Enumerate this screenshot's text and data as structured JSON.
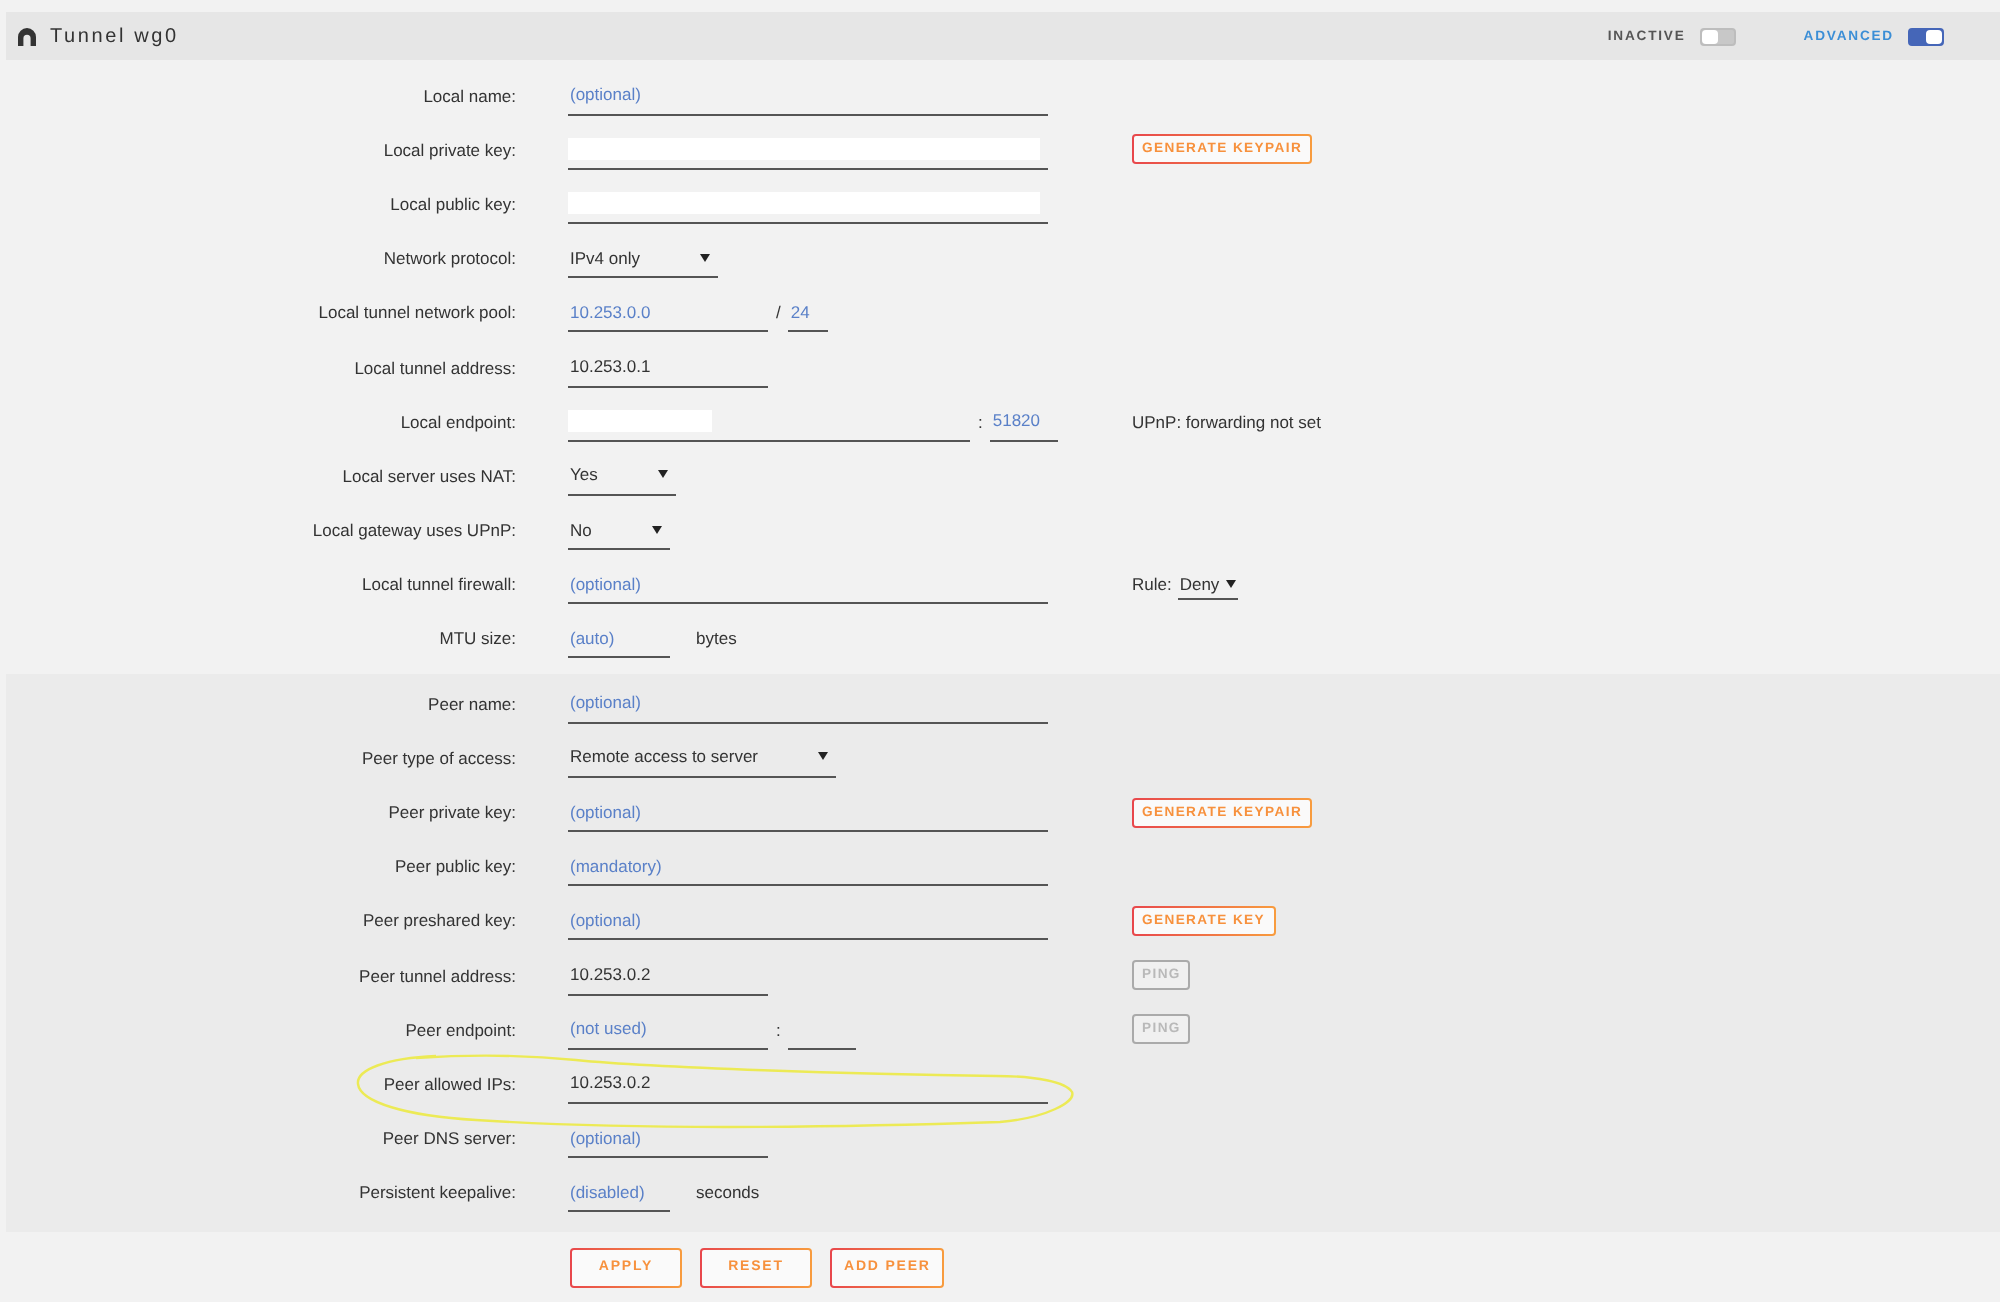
{
  "header": {
    "title": "Tunnel wg0",
    "switches": [
      {
        "label": "INACTIVE",
        "on": false
      },
      {
        "label": "ADVANCED",
        "on": true
      }
    ]
  },
  "sections": [
    {
      "rows": [
        {
          "label": "Local name:",
          "highlighted": false,
          "fields": [
            {
              "kind": "text",
              "placeholder": "(optional)",
              "redacted": false
            }
          ]
        },
        {
          "label": "Local private key:",
          "highlighted": false,
          "fields": [
            {
              "kind": "text",
              "redacted": true
            }
          ],
          "aside": {
            "kind": "button",
            "label": "GENERATE KEYPAIR",
            "disabled": false
          }
        },
        {
          "label": "Local public key:",
          "highlighted": false,
          "fields": [
            {
              "kind": "text",
              "redacted": true
            }
          ]
        },
        {
          "label": "Network protocol:",
          "highlighted": false,
          "fields": [
            {
              "kind": "select",
              "value": "IPv4 only"
            }
          ]
        },
        {
          "label": "Local tunnel network pool:",
          "highlighted": false,
          "fields": [
            {
              "kind": "address",
              "placeholder": "10.253.0.0",
              "redacted": false
            },
            {
              "kind": "separator",
              "text": "/"
            },
            {
              "kind": "prefix",
              "placeholder": "24",
              "redacted": false
            }
          ]
        },
        {
          "label": "Local tunnel address:",
          "highlighted": false,
          "fields": [
            {
              "kind": "address",
              "value": "10.253.0.1",
              "redacted": false
            }
          ]
        },
        {
          "label": "Local endpoint:",
          "highlighted": false,
          "fields": [
            {
              "kind": "host",
              "redacted": true
            },
            {
              "kind": "separator",
              "text": ":"
            },
            {
              "kind": "port",
              "placeholder": "51820",
              "redacted": false
            }
          ],
          "aside": {
            "kind": "note",
            "text": "UPnP: forwarding not set"
          }
        },
        {
          "label": "Local server uses NAT:",
          "highlighted": false,
          "fields": [
            {
              "kind": "select",
              "value": "Yes"
            }
          ]
        },
        {
          "label": "Local gateway uses UPnP:",
          "highlighted": false,
          "fields": [
            {
              "kind": "select",
              "value": "No"
            }
          ]
        },
        {
          "label": "Local tunnel firewall:",
          "highlighted": false,
          "fields": [
            {
              "kind": "text",
              "placeholder": "(optional)",
              "redacted": false
            }
          ],
          "aside": {
            "kind": "rule",
            "label": "Rule:",
            "value": "Deny"
          }
        },
        {
          "label": "MTU size:",
          "highlighted": false,
          "fields": [
            {
              "kind": "number",
              "placeholder": "(auto)",
              "redacted": false
            },
            {
              "kind": "unit",
              "text": "bytes"
            }
          ]
        }
      ]
    },
    {
      "rows": [
        {
          "label": "Peer name:",
          "highlighted": false,
          "fields": [
            {
              "kind": "text",
              "placeholder": "(optional)",
              "redacted": false
            }
          ]
        },
        {
          "label": "Peer type of access:",
          "highlighted": false,
          "fields": [
            {
              "kind": "select",
              "value": "Remote access to server"
            }
          ]
        },
        {
          "label": "Peer private key:",
          "highlighted": false,
          "fields": [
            {
              "kind": "text",
              "placeholder": "(optional)",
              "redacted": false
            }
          ],
          "aside": {
            "kind": "button",
            "label": "GENERATE KEYPAIR",
            "disabled": false
          }
        },
        {
          "label": "Peer public key:",
          "highlighted": false,
          "fields": [
            {
              "kind": "text",
              "placeholder": "(mandatory)",
              "redacted": false
            }
          ]
        },
        {
          "label": "Peer preshared key:",
          "highlighted": false,
          "fields": [
            {
              "kind": "text",
              "placeholder": "(optional)",
              "redacted": false
            }
          ],
          "aside": {
            "kind": "button",
            "label": "GENERATE KEY",
            "disabled": false
          }
        },
        {
          "label": "Peer tunnel address:",
          "highlighted": false,
          "fields": [
            {
              "kind": "address",
              "value": "10.253.0.2",
              "redacted": false
            }
          ],
          "aside": {
            "kind": "button",
            "label": "PING",
            "disabled": true
          }
        },
        {
          "label": "Peer endpoint:",
          "highlighted": false,
          "fields": [
            {
              "kind": "address",
              "placeholder": "(not used)",
              "redacted": false
            },
            {
              "kind": "separator",
              "text": ":"
            },
            {
              "kind": "port",
              "redacted": false
            }
          ],
          "aside": {
            "kind": "button",
            "label": "PING",
            "disabled": true
          }
        },
        {
          "label": "Peer allowed IPs:",
          "highlighted": true,
          "fields": [
            {
              "kind": "text",
              "value": "10.253.0.2",
              "redacted": false
            }
          ]
        },
        {
          "label": "Peer DNS server:",
          "highlighted": false,
          "fields": [
            {
              "kind": "address",
              "placeholder": "(optional)",
              "redacted": false
            }
          ]
        },
        {
          "label": "Persistent keepalive:",
          "highlighted": false,
          "fields": [
            {
              "kind": "number",
              "placeholder": "(disabled)",
              "redacted": false
            },
            {
              "kind": "unit",
              "text": "seconds"
            }
          ]
        }
      ]
    }
  ],
  "actions": [
    "APPLY",
    "RESET",
    "ADD PEER"
  ]
}
